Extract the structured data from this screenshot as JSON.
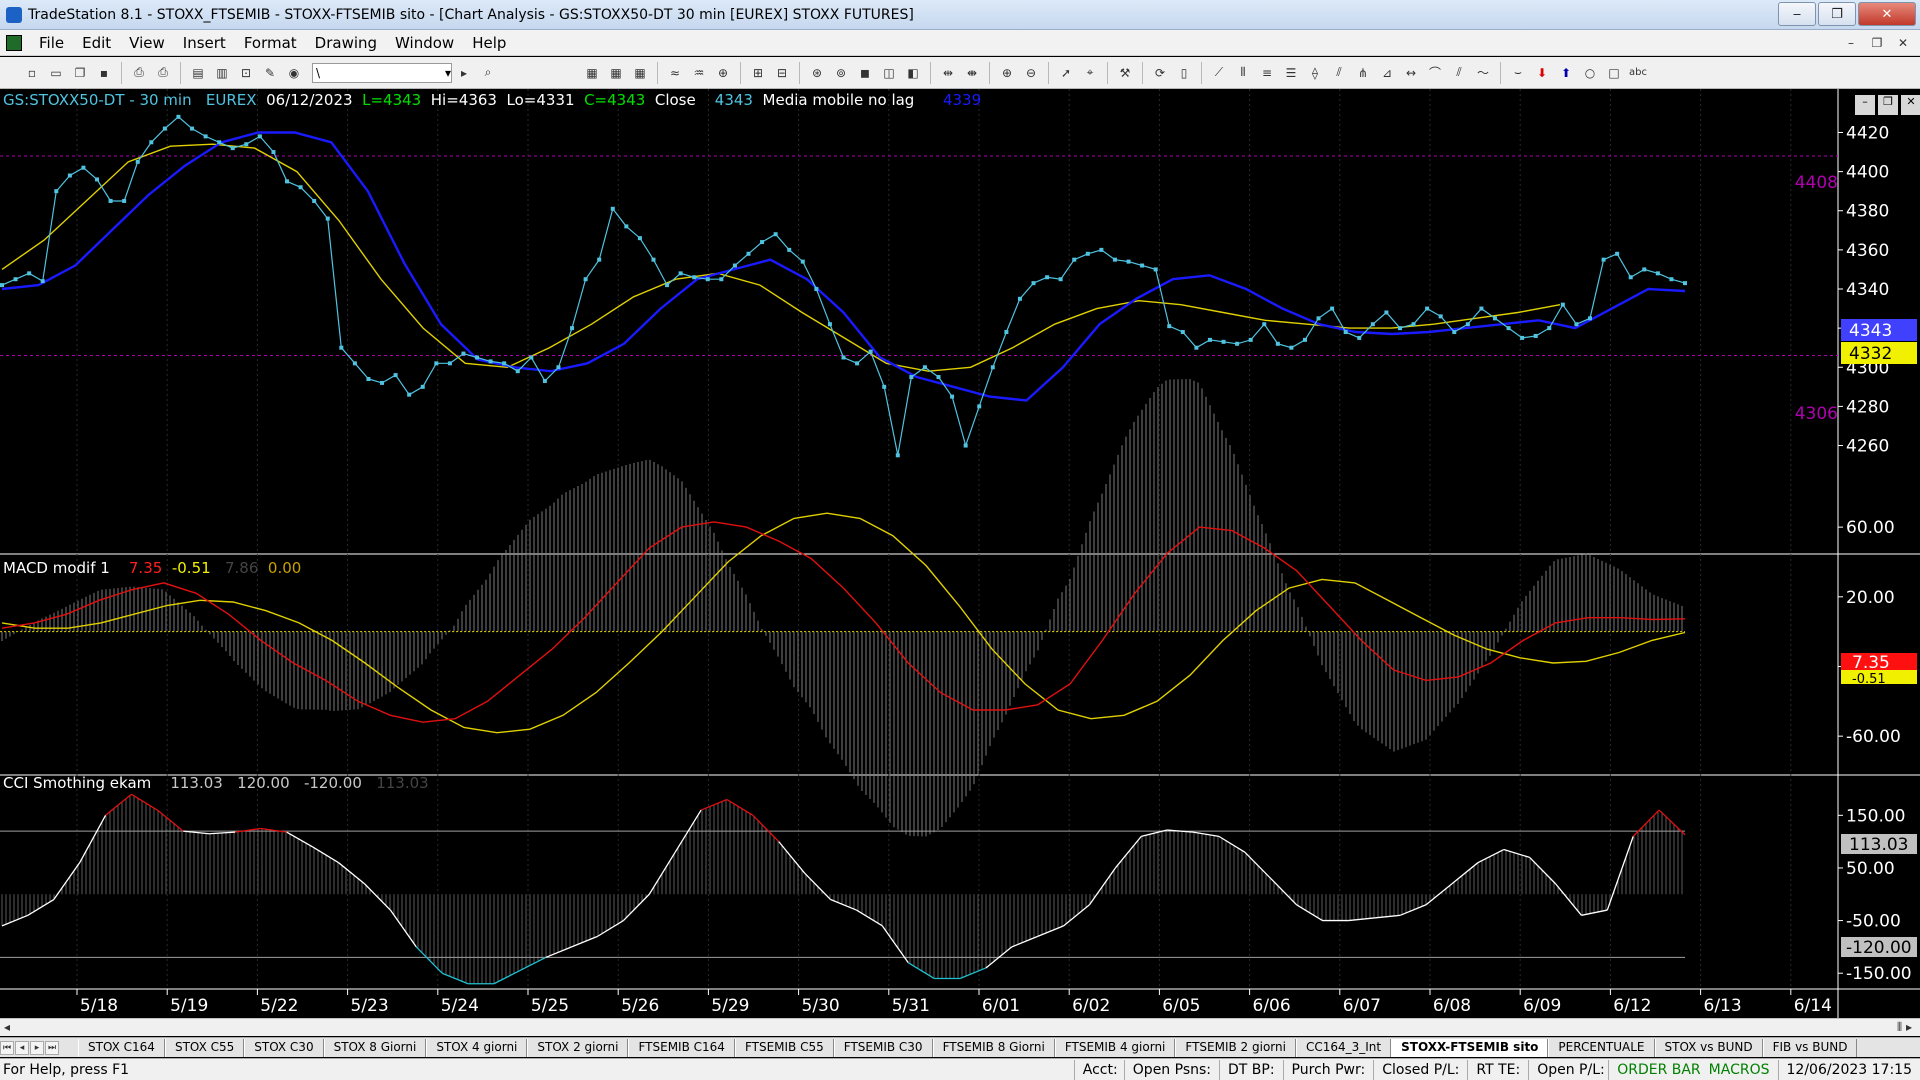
{
  "window": {
    "title": "TradeStation 8.1 - STOXX_FTSEMIB - STOXX-FTSEMIB sito - [Chart Analysis - GS:STOXX50-DT  30 min  [EUREX] STOXX FUTURES]",
    "minimize": "‒",
    "restore": "❐",
    "close": "✕"
  },
  "menu": [
    "File",
    "Edit",
    "View",
    "Insert",
    "Format",
    "Drawing",
    "Window",
    "Help"
  ],
  "mdi_buttons": [
    "–",
    "❐",
    "✕"
  ],
  "toolbar": {
    "drawing_combo_value": "\\"
  },
  "price_header": {
    "symbol": "GS:STOXX50-DT - 30 min",
    "exchange": "EUREX",
    "date": "06/12/2023",
    "last": "L=4343",
    "high": "Hi=4363",
    "low": "Lo=4331",
    "close": "C=4343",
    "close_label": "Close",
    "close_value": "4343",
    "indicator_name": "Media mobile no lag",
    "indicator_value": "4339"
  },
  "macd_header": {
    "name": "MACD modif 1",
    "v1": "7.35",
    "v2": "-0.51",
    "v3": "7.86",
    "v4": "0.00"
  },
  "cci_header": {
    "name": "CCI Smothing ekam",
    "v1": "113.03",
    "v2": "120.00",
    "v3": "-120.00",
    "v4": "113.03"
  },
  "colors": {
    "price_line": "#4fc3e0",
    "fast_ma": "#1a1aff",
    "slow_ma": "#e0d000",
    "macd_line": "#e01010",
    "signal_line": "#e0d000",
    "histogram": "#808080",
    "level_line": "#b000b0",
    "cci_line": "#ffffff",
    "cci_overbought": "#e01010",
    "cci_oversold": "#20c0d0"
  },
  "price_levels": {
    "upper": "4408",
    "lower": "4306",
    "last_tag": "4343",
    "ma_tag": "4332"
  },
  "macd_tags": {
    "macd_value": "7.35",
    "signal_value": "-0.51"
  },
  "cci_tags": {
    "cci_value": "113.03",
    "lower_band": "-120.00"
  },
  "chart_data": [
    {
      "type": "line",
      "title": "GS:STOXX50-DT - 30 min",
      "y_ticks": [
        "4420",
        "4400",
        "4380",
        "4360",
        "4340",
        "4320",
        "4300",
        "4280",
        "4260"
      ],
      "x_categories": [
        "5/18",
        "5/19",
        "5/22",
        "5/23",
        "5/24",
        "5/25",
        "5/26",
        "5/29",
        "5/30",
        "5/31",
        "6/01",
        "6/02",
        "6/05",
        "6/06",
        "6/07",
        "6/08",
        "6/09",
        "6/12",
        "6/13",
        "6/14"
      ],
      "ylim": [
        4248,
        4432
      ],
      "series": [
        {
          "name": "Close",
          "values": [
            4342,
            4345,
            4348,
            4344,
            4390,
            4398,
            4402,
            4396,
            4385,
            4385,
            4405,
            4415,
            4422,
            4428,
            4422,
            4418,
            4415,
            4412,
            4414,
            4418,
            4410,
            4395,
            4392,
            4385,
            4376,
            4310,
            4302,
            4294,
            4292,
            4296,
            4286,
            4290,
            4302,
            4302,
            4307,
            4305,
            4303,
            4302,
            4298,
            4305,
            4293,
            4300,
            4320,
            4345,
            4355,
            4381,
            4372,
            4366,
            4355,
            4342,
            4348,
            4346,
            4345,
            4345,
            4352,
            4358,
            4364,
            4368,
            4360,
            4354,
            4340,
            4322,
            4305,
            4302,
            4308,
            4290,
            4255,
            4295,
            4300,
            4295,
            4285,
            4260,
            4280,
            4300,
            4318,
            4335,
            4343,
            4346,
            4345,
            4355,
            4358,
            4360,
            4355,
            4354,
            4352,
            4350,
            4321,
            4318,
            4310,
            4314,
            4313,
            4312,
            4314,
            4322,
            4312,
            4310,
            4314,
            4325,
            4330,
            4318,
            4315,
            4322,
            4328,
            4320,
            4322,
            4330,
            4326,
            4318,
            4322,
            4330,
            4325,
            4320,
            4315,
            4316,
            4320,
            4332,
            4322,
            4325,
            4355,
            4358,
            4346,
            4350,
            4348,
            4345,
            4343
          ]
        },
        {
          "name": "Media mobile no lag",
          "values": [
            4340,
            4342,
            4352,
            4370,
            4388,
            4403,
            4415,
            4420,
            4420,
            4415,
            4390,
            4353,
            4322,
            4304,
            4300,
            4298,
            4302,
            4312,
            4330,
            4345,
            4350,
            4355,
            4345,
            4328,
            4305,
            4295,
            4290,
            4285,
            4283,
            4300,
            4322,
            4335,
            4345,
            4347,
            4340,
            4330,
            4322,
            4318,
            4317,
            4318,
            4320,
            4322,
            4324,
            4320,
            4330,
            4340,
            4339
          ]
        },
        {
          "name": "Slow MA",
          "values": [
            4350,
            4365,
            4385,
            4405,
            4413,
            4414,
            4412,
            4400,
            4375,
            4345,
            4320,
            4302,
            4300,
            4310,
            4322,
            4336,
            4345,
            4348,
            4342,
            4328,
            4315,
            4302,
            4298,
            4300,
            4310,
            4322,
            4330,
            4334,
            4332,
            4328,
            4324,
            4322,
            4320,
            4320,
            4322,
            4325,
            4328,
            4332
          ]
        }
      ]
    },
    {
      "type": "line",
      "title": "MACD modif 1",
      "y_ticks": [
        "60.00",
        "20.00",
        "-20.00",
        "-60.00"
      ],
      "ylim": [
        -80,
        75
      ],
      "series": [
        {
          "name": "MACD",
          "values": [
            2,
            5,
            10,
            18,
            24,
            28,
            22,
            10,
            -5,
            -18,
            -28,
            -40,
            -48,
            -52,
            -50,
            -40,
            -25,
            -10,
            8,
            28,
            48,
            60,
            63,
            60,
            52,
            42,
            25,
            5,
            -18,
            -35,
            -45,
            -45,
            -42,
            -30,
            -5,
            22,
            45,
            60,
            58,
            48,
            35,
            15,
            -5,
            -22,
            -28,
            -26,
            -18,
            -5,
            5,
            8,
            8,
            7,
            7.35
          ]
        },
        {
          "name": "Signal",
          "values": [
            5,
            2,
            2,
            5,
            10,
            15,
            18,
            17,
            12,
            5,
            -5,
            -18,
            -32,
            -45,
            -55,
            -58,
            -56,
            -48,
            -35,
            -18,
            0,
            20,
            40,
            55,
            65,
            68,
            65,
            55,
            38,
            15,
            -10,
            -30,
            -45,
            -50,
            -48,
            -40,
            -25,
            -5,
            12,
            25,
            30,
            28,
            18,
            8,
            -2,
            -10,
            -15,
            -18,
            -17,
            -12,
            -5,
            -0.51
          ]
        }
      ]
    },
    {
      "type": "line",
      "title": "CCI Smothing ekam",
      "y_ticks": [
        "150.00",
        "50.00",
        "-50.00",
        "-150.00"
      ],
      "ylim": [
        -180,
        200
      ],
      "series": [
        {
          "name": "CCI",
          "values": [
            -60,
            -40,
            -10,
            60,
            150,
            190,
            160,
            120,
            115,
            118,
            125,
            118,
            90,
            60,
            20,
            -30,
            -100,
            -150,
            -170,
            -170,
            -145,
            -120,
            -100,
            -80,
            -50,
            0,
            80,
            160,
            180,
            150,
            100,
            40,
            -10,
            -30,
            -60,
            -130,
            -160,
            -160,
            -140,
            -100,
            -80,
            -60,
            -20,
            50,
            110,
            122,
            118,
            110,
            80,
            30,
            -20,
            -50,
            -50,
            -45,
            -40,
            -20,
            20,
            60,
            85,
            70,
            20,
            -40,
            -30,
            110,
            160,
            113.03
          ]
        }
      ],
      "levels": [
        120,
        -120
      ]
    }
  ],
  "tabs": [
    "STOX C164",
    "STOX C55",
    "STOX  C30",
    "STOX  8 Giorni",
    "STOX 4 giorni",
    "STOX  2 giorni",
    "FTSEMIB C164",
    "FTSEMIB C55",
    "FTSEMIB C30",
    "FTSEMIB  8 Giorni",
    "FTSEMIB  4 giorni",
    "FTSEMIB  2 giorni",
    "CC164_3_Int",
    "STOXX-FTSEMIB sito",
    "PERCENTUALE",
    "STOX vs BUND",
    "FIB vs BUND"
  ],
  "active_tab": "STOXX-FTSEMIB sito",
  "statusbar": {
    "help": "For Help, press F1",
    "acct": "Acct:",
    "open_psns": "Open Psns:",
    "dt_bp": "DT BP:",
    "purch_pwr": "Purch Pwr:",
    "closed_pl": "Closed P/L:",
    "rt_te": "RT TE:",
    "open_pl": "Open P/L:",
    "order_bar": "ORDER BAR",
    "macros": "MACROS",
    "datetime": "12/06/2023 17:15"
  }
}
